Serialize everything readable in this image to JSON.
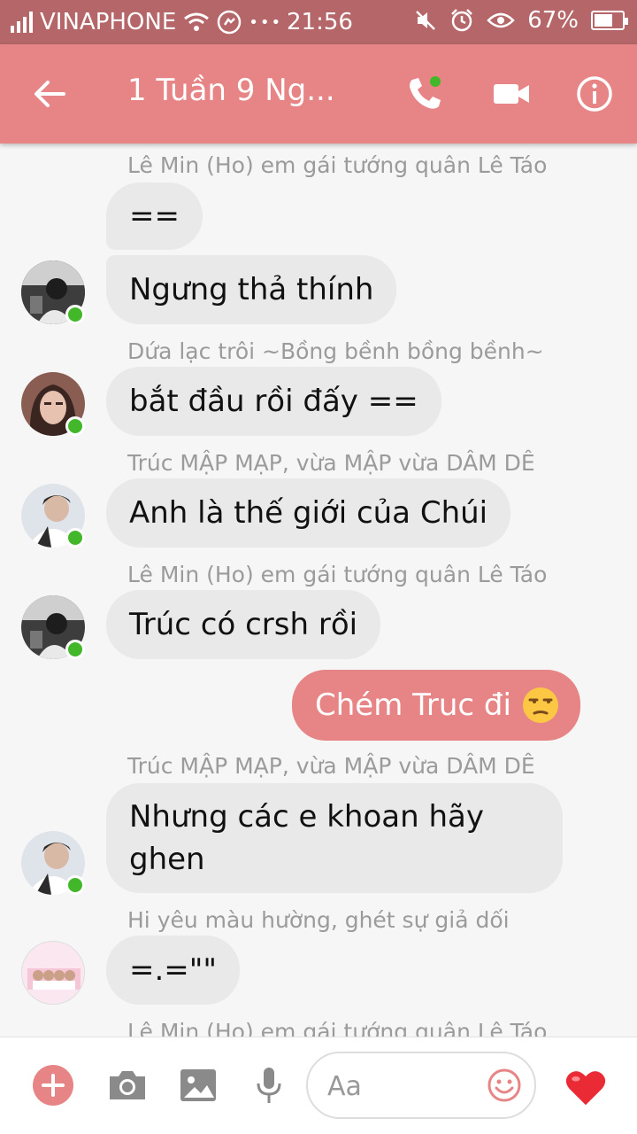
{
  "status_bar": {
    "carrier": "VINAPHONE",
    "time": "21:56",
    "battery": "67%",
    "battery_level": 0.67,
    "dots": "•••"
  },
  "header": {
    "title": "1 Tuần 9 Ng...",
    "icons": [
      "back-arrow-icon",
      "phone-icon",
      "video-camera-icon",
      "info-icon"
    ],
    "accent": "#e78586"
  },
  "messages": [
    {
      "sender": "Lê Min (Ho) em gái tướng quân Lê Táo",
      "text": "=="
    },
    {
      "text": "Ngưng thả thính"
    },
    {
      "sender": "Dứa lạc trôi ~Bồng bềnh bồng bềnh~",
      "text": "bắt đầu rồi đấy =="
    },
    {
      "sender": "Trúc MẬP MẠP, vừa MẬP vừa DÂM DÊ",
      "text": "Anh là thế giới của Chúi"
    },
    {
      "sender": "Lê Min (Ho) em gái tướng quân Lê Táo",
      "text": "Trúc có crsh rồi"
    },
    {
      "text": "Chém Truc đi",
      "outgoing": true
    },
    {
      "sender": "Trúc MẬP MẠP, vừa MẬP vừa DÂM DÊ",
      "text": "Nhưng các e khoan hãy ghen"
    },
    {
      "sender": "Hi yêu màu hường, ghét sự giả dối",
      "text": "=.=\"\""
    },
    {
      "sender": "Lê Min (Ho) em gái tướng quân Lê Táo"
    }
  ],
  "composer": {
    "placeholder": "Aa",
    "icons": [
      "plus-icon",
      "camera-icon",
      "image-icon",
      "microphone-icon",
      "emoji-icon",
      "heart-icon"
    ]
  }
}
